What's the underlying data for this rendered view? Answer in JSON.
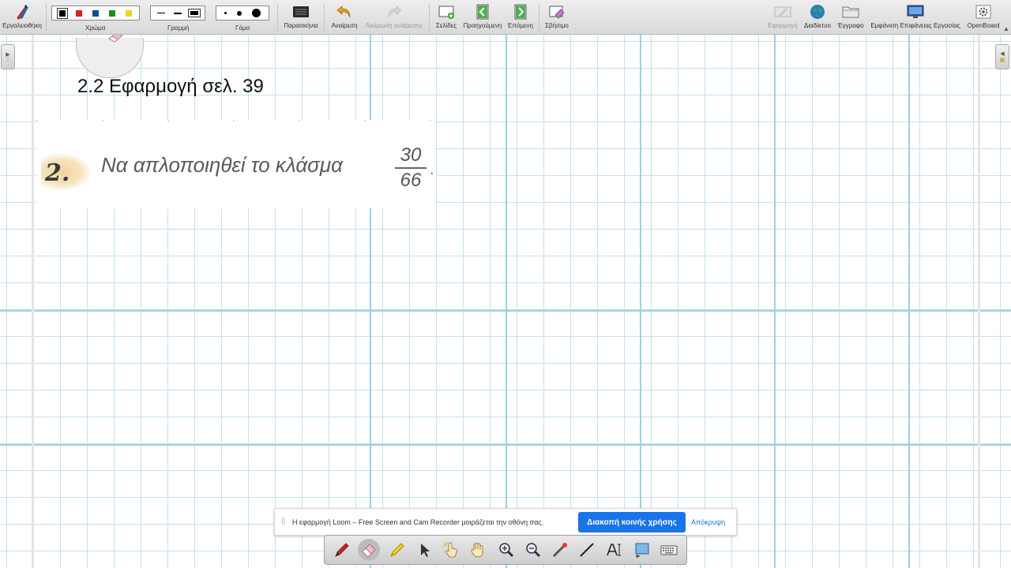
{
  "toolbar": {
    "toolbox_label": "Εργαλειοθήκη",
    "color_label": "Χρώμα",
    "line_label": "Γραμμή",
    "eraser_size_label": "Γόμα",
    "background_label": "Παρασκήνια",
    "undo_label": "Αναίρεση",
    "redo_label": "Ακύρωση αναίρεσης",
    "pages_label": "Σελίδες",
    "previous_label": "Προηγούμενη",
    "next_label": "Επόμενη",
    "erase_label": "Σβήσιμο",
    "application_label": "Εφαρμογή",
    "web_label": "Διαδίκτυο",
    "document_label": "Έγγραφο",
    "desktop_label": "Εμφάνιση Επιφάνειας Εργασίας",
    "openboard_label": "OpenBoard"
  },
  "colors": {
    "swatches": [
      "#000000",
      "#e11e1e",
      "#0b4f8e",
      "#1a8f1a",
      "#f2d41b"
    ],
    "grid": "#c3e2ee",
    "accent": "#1a73e8"
  },
  "page": {
    "heading": "2.2 Εφαρμογή σελ. 39"
  },
  "exercise": {
    "number": "2.",
    "text": "Να απλοποιηθεί το κλάσμα",
    "numerator": "30",
    "denominator": "66",
    "trailing": "."
  },
  "loom": {
    "message": "Η εφαρμογή Loom – Free Screen and Cam Recorder μοιράζεται την οθόνη σας.",
    "stop_label": "Διακοπή κοινής χρήσης",
    "hide_label": "Απόκρυψη"
  },
  "palette": {
    "tools": [
      "pen-icon",
      "eraser-icon",
      "marker-icon",
      "selector-icon",
      "interact-icon",
      "hand-icon",
      "zoom-in-icon",
      "zoom-out-icon",
      "laser-pointer-icon",
      "line-icon",
      "text-icon",
      "capture-icon",
      "keyboard-icon"
    ],
    "active_tool": "eraser-icon"
  }
}
